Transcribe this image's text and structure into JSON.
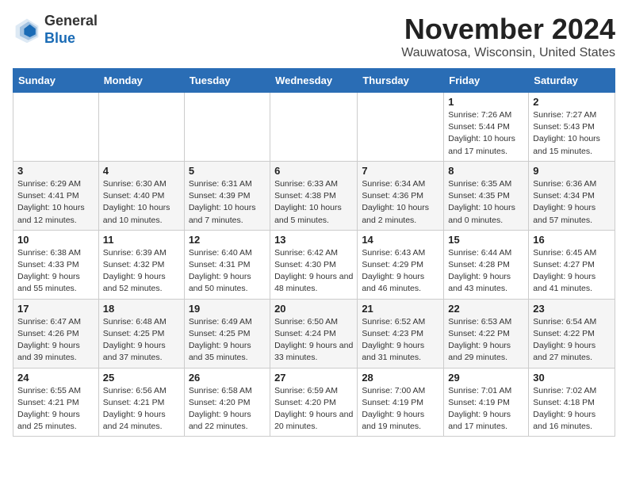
{
  "logo": {
    "line1": "General",
    "line2": "Blue"
  },
  "title": "November 2024",
  "location": "Wauwatosa, Wisconsin, United States",
  "columns": [
    "Sunday",
    "Monday",
    "Tuesday",
    "Wednesday",
    "Thursday",
    "Friday",
    "Saturday"
  ],
  "weeks": [
    [
      {
        "day": "",
        "info": ""
      },
      {
        "day": "",
        "info": ""
      },
      {
        "day": "",
        "info": ""
      },
      {
        "day": "",
        "info": ""
      },
      {
        "day": "",
        "info": ""
      },
      {
        "day": "1",
        "info": "Sunrise: 7:26 AM\nSunset: 5:44 PM\nDaylight: 10 hours and 17 minutes."
      },
      {
        "day": "2",
        "info": "Sunrise: 7:27 AM\nSunset: 5:43 PM\nDaylight: 10 hours and 15 minutes."
      }
    ],
    [
      {
        "day": "3",
        "info": "Sunrise: 6:29 AM\nSunset: 4:41 PM\nDaylight: 10 hours and 12 minutes."
      },
      {
        "day": "4",
        "info": "Sunrise: 6:30 AM\nSunset: 4:40 PM\nDaylight: 10 hours and 10 minutes."
      },
      {
        "day": "5",
        "info": "Sunrise: 6:31 AM\nSunset: 4:39 PM\nDaylight: 10 hours and 7 minutes."
      },
      {
        "day": "6",
        "info": "Sunrise: 6:33 AM\nSunset: 4:38 PM\nDaylight: 10 hours and 5 minutes."
      },
      {
        "day": "7",
        "info": "Sunrise: 6:34 AM\nSunset: 4:36 PM\nDaylight: 10 hours and 2 minutes."
      },
      {
        "day": "8",
        "info": "Sunrise: 6:35 AM\nSunset: 4:35 PM\nDaylight: 10 hours and 0 minutes."
      },
      {
        "day": "9",
        "info": "Sunrise: 6:36 AM\nSunset: 4:34 PM\nDaylight: 9 hours and 57 minutes."
      }
    ],
    [
      {
        "day": "10",
        "info": "Sunrise: 6:38 AM\nSunset: 4:33 PM\nDaylight: 9 hours and 55 minutes."
      },
      {
        "day": "11",
        "info": "Sunrise: 6:39 AM\nSunset: 4:32 PM\nDaylight: 9 hours and 52 minutes."
      },
      {
        "day": "12",
        "info": "Sunrise: 6:40 AM\nSunset: 4:31 PM\nDaylight: 9 hours and 50 minutes."
      },
      {
        "day": "13",
        "info": "Sunrise: 6:42 AM\nSunset: 4:30 PM\nDaylight: 9 hours and 48 minutes."
      },
      {
        "day": "14",
        "info": "Sunrise: 6:43 AM\nSunset: 4:29 PM\nDaylight: 9 hours and 46 minutes."
      },
      {
        "day": "15",
        "info": "Sunrise: 6:44 AM\nSunset: 4:28 PM\nDaylight: 9 hours and 43 minutes."
      },
      {
        "day": "16",
        "info": "Sunrise: 6:45 AM\nSunset: 4:27 PM\nDaylight: 9 hours and 41 minutes."
      }
    ],
    [
      {
        "day": "17",
        "info": "Sunrise: 6:47 AM\nSunset: 4:26 PM\nDaylight: 9 hours and 39 minutes."
      },
      {
        "day": "18",
        "info": "Sunrise: 6:48 AM\nSunset: 4:25 PM\nDaylight: 9 hours and 37 minutes."
      },
      {
        "day": "19",
        "info": "Sunrise: 6:49 AM\nSunset: 4:25 PM\nDaylight: 9 hours and 35 minutes."
      },
      {
        "day": "20",
        "info": "Sunrise: 6:50 AM\nSunset: 4:24 PM\nDaylight: 9 hours and 33 minutes."
      },
      {
        "day": "21",
        "info": "Sunrise: 6:52 AM\nSunset: 4:23 PM\nDaylight: 9 hours and 31 minutes."
      },
      {
        "day": "22",
        "info": "Sunrise: 6:53 AM\nSunset: 4:22 PM\nDaylight: 9 hours and 29 minutes."
      },
      {
        "day": "23",
        "info": "Sunrise: 6:54 AM\nSunset: 4:22 PM\nDaylight: 9 hours and 27 minutes."
      }
    ],
    [
      {
        "day": "24",
        "info": "Sunrise: 6:55 AM\nSunset: 4:21 PM\nDaylight: 9 hours and 25 minutes."
      },
      {
        "day": "25",
        "info": "Sunrise: 6:56 AM\nSunset: 4:21 PM\nDaylight: 9 hours and 24 minutes."
      },
      {
        "day": "26",
        "info": "Sunrise: 6:58 AM\nSunset: 4:20 PM\nDaylight: 9 hours and 22 minutes."
      },
      {
        "day": "27",
        "info": "Sunrise: 6:59 AM\nSunset: 4:20 PM\nDaylight: 9 hours and 20 minutes."
      },
      {
        "day": "28",
        "info": "Sunrise: 7:00 AM\nSunset: 4:19 PM\nDaylight: 9 hours and 19 minutes."
      },
      {
        "day": "29",
        "info": "Sunrise: 7:01 AM\nSunset: 4:19 PM\nDaylight: 9 hours and 17 minutes."
      },
      {
        "day": "30",
        "info": "Sunrise: 7:02 AM\nSunset: 4:18 PM\nDaylight: 9 hours and 16 minutes."
      }
    ]
  ]
}
